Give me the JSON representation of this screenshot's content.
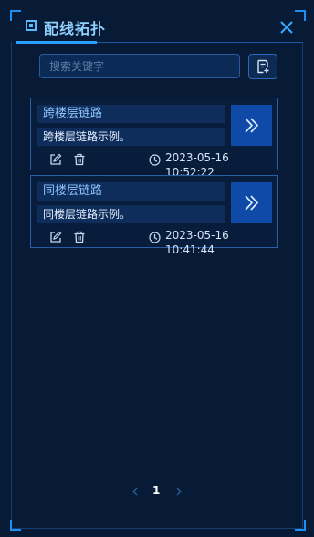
{
  "header": {
    "title": "配线拓扑"
  },
  "search": {
    "placeholder": "搜索关键字",
    "value": ""
  },
  "records": [
    {
      "name": "跨楼层链路",
      "description": "跨楼层链路示例。",
      "time": "2023-05-16 10:52:22"
    },
    {
      "name": "同楼层链路",
      "description": "同楼层链路示例。",
      "time": "2023-05-16 10:41:44"
    }
  ],
  "pagination": {
    "current_page": "1"
  },
  "icons": {
    "title": "square-icon",
    "close": "close-icon",
    "add": "add-file-icon",
    "go": "double-chevron-right-icon",
    "edit": "edit-icon",
    "delete": "trash-icon",
    "clock": "clock-icon",
    "prev": "chevron-left-icon",
    "next": "chevron-right-icon"
  },
  "colors": {
    "accent": "#28a0ff",
    "background": "#071b36",
    "card_border": "#2a5fa6",
    "go_button": "#0f4aa8"
  }
}
